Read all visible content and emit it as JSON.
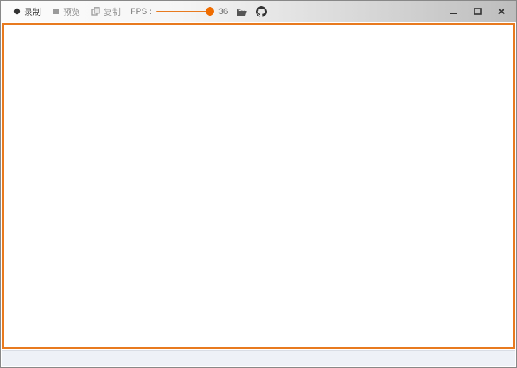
{
  "toolbar": {
    "record_label": "录制",
    "preview_label": "预览",
    "copy_label": "复制",
    "fps_label": "FPS :",
    "fps_value": "36",
    "fps_slider_percent": 92
  },
  "colors": {
    "accent": "#e87a1f"
  }
}
